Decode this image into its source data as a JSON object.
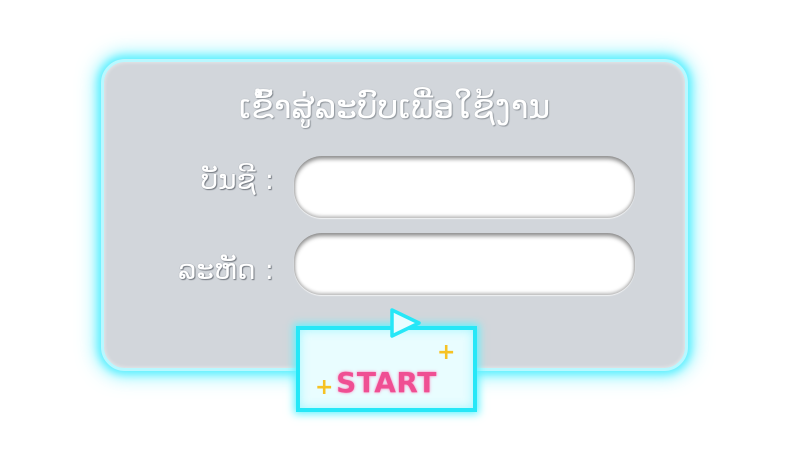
{
  "login": {
    "title": "ເຂົ້າສູ່ລະບົບເພື່ອໃຊ້ງານ",
    "account_label": "ບັນຊີ :",
    "password_label": "ລະຫັດ :",
    "account_value": "",
    "password_value": ""
  },
  "start_button": {
    "label": "START"
  },
  "icons": {
    "play": "play-triangle-icon",
    "sparkle": "plus-sparkle-icon"
  },
  "colors": {
    "panel_bg": "#d2d6db",
    "neon_glow": "#5ff0ff",
    "start_text": "#ef4f93",
    "sparkle": "#f6c224"
  }
}
